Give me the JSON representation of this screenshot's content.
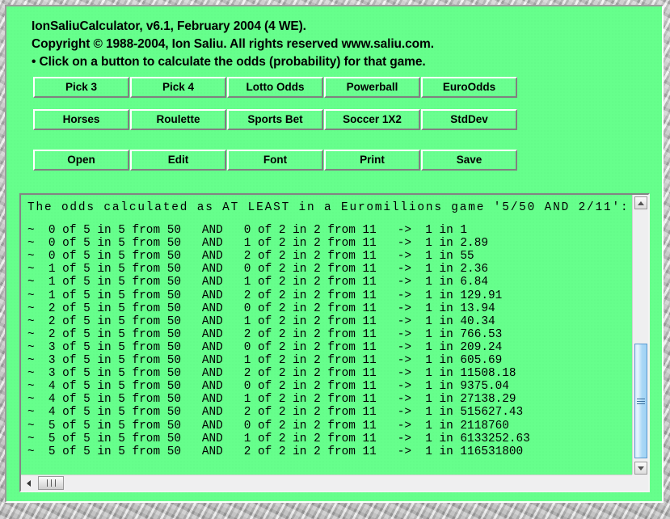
{
  "header": {
    "line1": "IonSaliuCalculator, v6.1, February 2004 (4 WE).",
    "line2": "Copyright © 1988-2004, Ion Saliu. All rights reserved www.saliu.com.",
    "line3": "• Click on a button to calculate the odds (probability) for that game."
  },
  "buttons": {
    "row1": [
      "Pick 3",
      "Pick 4",
      "Lotto Odds",
      "Powerball",
      "EuroOdds"
    ],
    "row2": [
      "Horses",
      "Roulette",
      "Sports Bet",
      "Soccer 1X2",
      "StdDev"
    ],
    "row3": [
      "Open",
      "Edit",
      "Font",
      "Print",
      "Save"
    ]
  },
  "output": {
    "title": "The odds calculated as AT LEAST in a Euromillions game '5/50 AND 2/11':",
    "lines": [
      "~  0 of 5 in 5 from 50   AND   0 of 2 in 2 from 11   ->  1 in 1",
      "~  0 of 5 in 5 from 50   AND   1 of 2 in 2 from 11   ->  1 in 2.89",
      "~  0 of 5 in 5 from 50   AND   2 of 2 in 2 from 11   ->  1 in 55",
      "~  1 of 5 in 5 from 50   AND   0 of 2 in 2 from 11   ->  1 in 2.36",
      "~  1 of 5 in 5 from 50   AND   1 of 2 in 2 from 11   ->  1 in 6.84",
      "~  1 of 5 in 5 from 50   AND   2 of 2 in 2 from 11   ->  1 in 129.91",
      "~  2 of 5 in 5 from 50   AND   0 of 2 in 2 from 11   ->  1 in 13.94",
      "~  2 of 5 in 5 from 50   AND   1 of 2 in 2 from 11   ->  1 in 40.34",
      "~  2 of 5 in 5 from 50   AND   2 of 2 in 2 from 11   ->  1 in 766.53",
      "~  3 of 5 in 5 from 50   AND   0 of 2 in 2 from 11   ->  1 in 209.24",
      "~  3 of 5 in 5 from 50   AND   1 of 2 in 2 from 11   ->  1 in 605.69",
      "~  3 of 5 in 5 from 50   AND   2 of 2 in 2 from 11   ->  1 in 11508.18",
      "~  4 of 5 in 5 from 50   AND   0 of 2 in 2 from 11   ->  1 in 9375.04",
      "~  4 of 5 in 5 from 50   AND   1 of 2 in 2 from 11   ->  1 in 27138.29",
      "~  4 of 5 in 5 from 50   AND   2 of 2 in 2 from 11   ->  1 in 515627.43",
      "~  5 of 5 in 5 from 50   AND   0 of 2 in 2 from 11   ->  1 in 2118760",
      "~  5 of 5 in 5 from 50   AND   1 of 2 in 2 from 11   ->  1 in 6133252.63",
      "~  5 of 5 in 5 from 50   AND   2 of 2 in 2 from 11   ->  1 in 116531800"
    ]
  },
  "scrollbars": {
    "vertical": {
      "up_icon": "triangle-up-icon",
      "down_icon": "triangle-down-icon",
      "thumb_icon": "grip-lines-horizontal-icon"
    },
    "horizontal": {
      "left_icon": "triangle-left-icon",
      "right_icon": "triangle-right-icon",
      "thumb_icon": "grip-lines-vertical-icon"
    }
  },
  "colors": {
    "window_green": "#66ff8c",
    "button_green": "#6aff90",
    "scroll_thumb_blue": "#aad8f6",
    "frame_gray": "#c8c8c8"
  }
}
